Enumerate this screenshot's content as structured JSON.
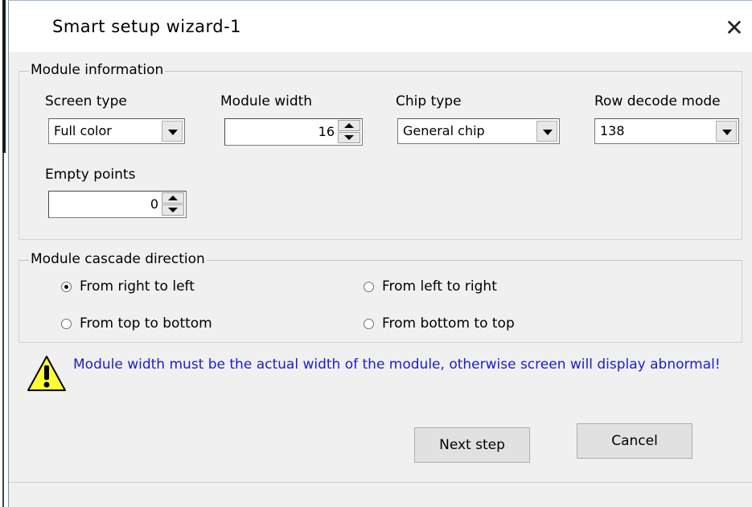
{
  "window": {
    "title": "Smart setup wizard-1",
    "close_icon": "close-icon"
  },
  "module_info": {
    "legend": "Module information",
    "screen_type": {
      "label": "Screen type",
      "value": "Full color"
    },
    "module_width": {
      "label": "Module width",
      "value": "16"
    },
    "chip_type": {
      "label": "Chip type",
      "value": "General chip"
    },
    "row_decode": {
      "label": "Row decode mode",
      "value": "138"
    },
    "empty_points": {
      "label": "Empty points",
      "value": "0"
    }
  },
  "cascade": {
    "legend": "Module cascade direction",
    "options": [
      {
        "label": "From right to left",
        "selected": true
      },
      {
        "label": "From left to right",
        "selected": false
      },
      {
        "label": "From top to bottom",
        "selected": false
      },
      {
        "label": "From bottom to top",
        "selected": false
      }
    ]
  },
  "warning": {
    "icon": "warning-icon",
    "text": "Module width must be the actual width of the module, otherwise screen will display abnormal!",
    "color": "#1d1dc8"
  },
  "buttons": {
    "next": "Next step",
    "cancel": "Cancel"
  }
}
